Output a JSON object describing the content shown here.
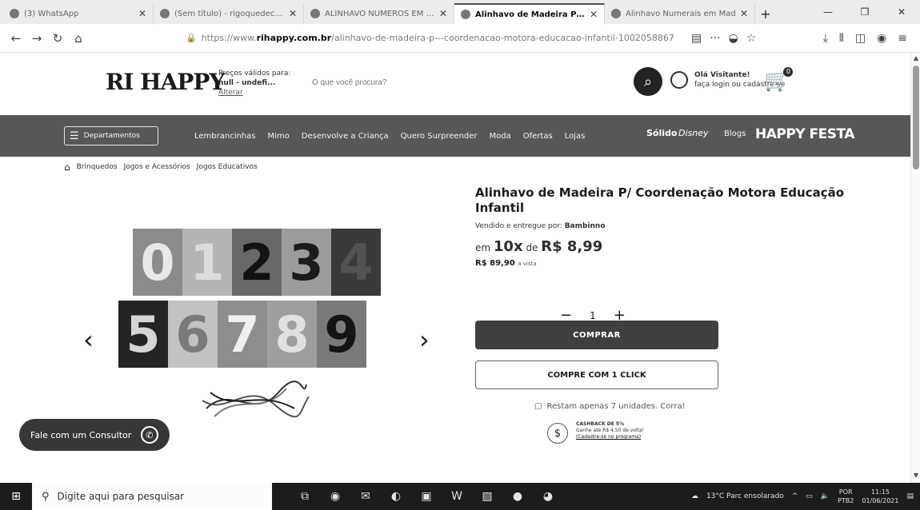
{
  "browser": {
    "tabs": [
      {
        "title": "(3) WhatsApp",
        "active": false
      },
      {
        "title": "(Sem título) - rigoquedec@u...",
        "active": false
      },
      {
        "title": "ALINHAVO NÚMEROS EM MDF",
        "active": false
      },
      {
        "title": "Alinhavo de Madeira P/ Coorde",
        "active": true
      },
      {
        "title": "Alinhavo Numerais em Mad",
        "active": false
      }
    ],
    "new_tab": "+",
    "url_prefix": "https://www.",
    "url_domain": "rihappy.com.br",
    "url_rest": "/alinhavo-de-madeira-p---coordenacao-motora-educacao-infantil-1002058867"
  },
  "site": {
    "logo": "RI HAPPY",
    "prices_label": "Preços válidos para:",
    "prices_location": "null - undefi...",
    "prices_change": "Alterar",
    "search_placeholder": "O que você procura?",
    "user_greeting": "Olá Visitante!",
    "user_action": "faça login ou cadastre-se",
    "cart_count": "0"
  },
  "menu": {
    "departments": "Departamentos",
    "items": [
      "Lembrancinhas",
      "Mimo",
      "Desenvolve a Criança",
      "Quero Surpreender",
      "Moda",
      "Ofertas",
      "Lojas"
    ],
    "brand_a": "Sólido",
    "brand_b": "Disney",
    "brand_c": "Blogs",
    "brand_d": "HAPPY FESTA"
  },
  "breadcrumb": [
    "Brinquedos",
    "Jogos e Acessórios",
    "Jogos Educativos"
  ],
  "product": {
    "title": "Alinhavo de Madeira P/ Coordenação Motora Educação Infantil",
    "seller_label": "Vendido e entregue por:",
    "seller": "Bambinno",
    "inst_prefix": "em",
    "inst_count": "10x",
    "inst_de": "de",
    "inst_value": "R$ 8,99",
    "cash_price": "R$ 89,90",
    "cash_suffix": "a vista",
    "quantity": "1",
    "buy_label": "COMPRAR",
    "one_click_label": "COMPRE COM 1 CLICK",
    "stock_msg": "Restam apenas 7 unidades. Corra!",
    "cashback_title": "CASHBACK DE 5%",
    "cashback_text": "Ganhe até R$ 4,50 de volta!",
    "cashback_link": "(Cadastre-se no programa)",
    "digits_row1": [
      "0",
      "1",
      "2",
      "3",
      "4"
    ],
    "digits_row2": [
      "5",
      "6",
      "7",
      "8",
      "9"
    ],
    "card_colors_row1": [
      "#8a8a8a",
      "#b0b0b0",
      "#6a6a6a",
      "#9a9a9a",
      "#3e3e3e"
    ],
    "card_colors_row2": [
      "#2a2a2a",
      "#bdbdbd",
      "#8c8c8c",
      "#9c9c9c",
      "#7a7a7a"
    ],
    "digit_colors_row1": [
      "#e0e0e0",
      "#d4d4d4",
      "#1a1a1a",
      "#222222",
      "#555555"
    ],
    "digit_colors_row2": [
      "#cfcfcf",
      "#7a7a7a",
      "#e8e8e8",
      "#d9d9d9",
      "#1c1c1c"
    ]
  },
  "chat_label": "Fale com um Consultor",
  "taskbar": {
    "search_placeholder": "Digite aqui para pesquisar",
    "weather": "13°C Parc ensolarado",
    "lang_top": "POR",
    "lang_bottom": "PTB2",
    "time": "11:15",
    "date": "01/06/2021"
  }
}
